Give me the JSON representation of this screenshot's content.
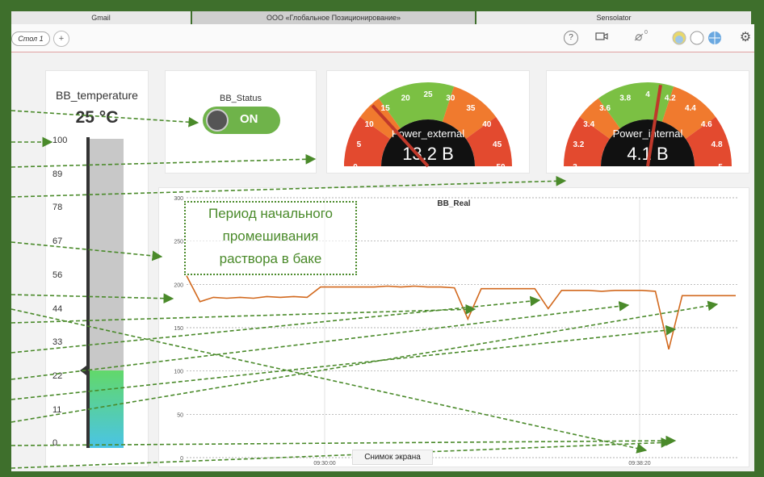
{
  "tabs": [
    {
      "label": "Gmail"
    },
    {
      "label": "ООО «Глобальное Позиционирование»"
    },
    {
      "label": "Sensolator"
    }
  ],
  "toolbar": {
    "desk_tab": "Стол 1",
    "plus": "+",
    "help": "?",
    "notify_count": "0"
  },
  "bb_temperature": {
    "title": "BB_temperature",
    "value": "25 °C",
    "ticks": [
      "100",
      "89",
      "78",
      "67",
      "56",
      "44",
      "33",
      "22",
      "11",
      "0"
    ],
    "level": 0.25
  },
  "bb_status": {
    "title": "BB_Status",
    "state": "ON"
  },
  "power_external": {
    "title": "Power_external",
    "value": "13.2 В",
    "ticks": [
      "0",
      "5",
      "10",
      "15",
      "20",
      "25",
      "30",
      "35",
      "40",
      "45",
      "50"
    ]
  },
  "power_internal": {
    "title": "Power_internal",
    "value": "4.1 В",
    "ticks": [
      "3",
      "3.2",
      "3.4",
      "3.6",
      "3.8",
      "4",
      "4.2",
      "4.4",
      "4.6",
      "4.8",
      "5"
    ]
  },
  "annotation": {
    "text_line1": "Период начального",
    "text_line2": "промешивания",
    "text_line3": "раствора в баке"
  },
  "tooltip": {
    "text": "Снимок экрана"
  },
  "colors": {
    "frame": "#3e6f2c",
    "line": "#d2691e",
    "gauge_red": "#e34a2f",
    "gauge_orange": "#f07a2e",
    "gauge_green": "#7bc043",
    "arrow": "#4a8a2a"
  },
  "chart_data": {
    "type": "line",
    "title": "BB_Real",
    "ylim": [
      0,
      300
    ],
    "y_ticks": [
      "300",
      "250",
      "200",
      "150",
      "100",
      "50",
      "0"
    ],
    "x_ticks": [
      "09:30:00",
      "09:38:20"
    ],
    "series": [
      {
        "values": [
          210,
          180,
          185,
          184,
          185,
          184,
          186,
          185,
          186,
          185,
          197,
          197,
          197,
          197,
          197,
          198,
          197,
          198,
          197,
          197,
          196,
          160,
          195,
          195,
          195,
          195,
          195,
          172,
          193,
          193,
          193,
          192,
          193,
          193,
          193,
          192,
          125,
          187,
          187,
          187,
          187,
          187
        ]
      }
    ]
  }
}
